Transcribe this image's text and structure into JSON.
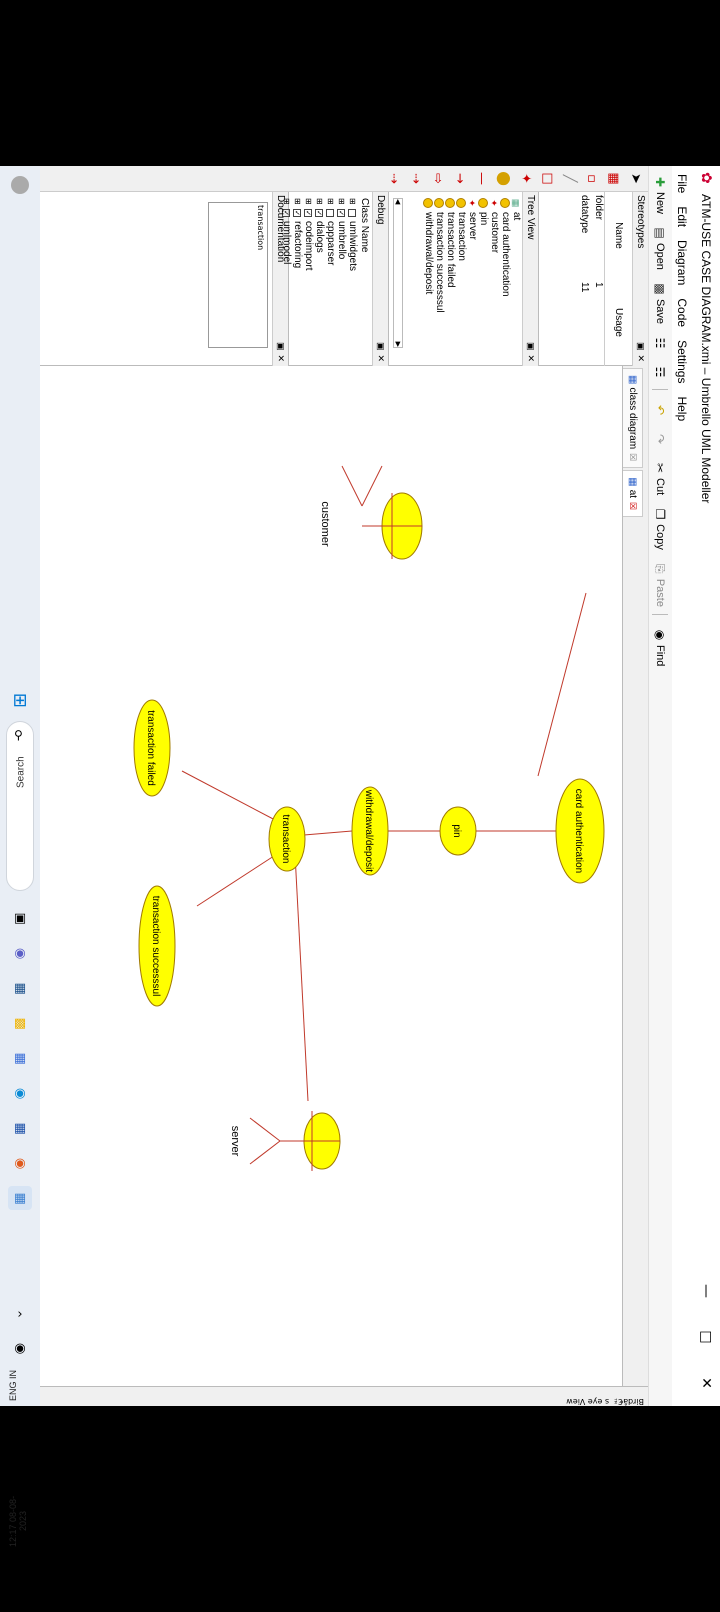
{
  "window": {
    "title": "ATM-USE CASE DIAGRAM.xmi – Umbrello UML Modeller",
    "minimize": "—",
    "maximize": "□",
    "close": "✕"
  },
  "menu": [
    "File",
    "Edit",
    "Diagram",
    "Code",
    "Settings",
    "Help"
  ],
  "toolbar": {
    "new": "New",
    "open": "Open",
    "save": "Save",
    "cut": "Cut",
    "copy": "Copy",
    "paste": "Paste",
    "find": "Find"
  },
  "stereotypes": {
    "title": "Stereotypes",
    "col_name": "Name",
    "col_usage": "Usage",
    "rows": [
      {
        "name": "folder",
        "usage": "1"
      },
      {
        "name": "datatype",
        "usage": "11"
      }
    ]
  },
  "tree_view": {
    "title": "Tree View",
    "items": [
      {
        "label": "at",
        "icon": "folder-icon"
      },
      {
        "label": "card authentication",
        "icon": "usecase-icon"
      },
      {
        "label": "customer",
        "icon": "actor-icon"
      },
      {
        "label": "pin",
        "icon": "usecase-icon"
      },
      {
        "label": "server",
        "icon": "actor-icon"
      },
      {
        "label": "transaction",
        "icon": "usecase-icon"
      },
      {
        "label": "transaction failed",
        "icon": "usecase-icon"
      },
      {
        "label": "transaction successsul",
        "icon": "usecase-icon"
      },
      {
        "label": "withdrawal/deposit",
        "icon": "usecase-icon"
      }
    ]
  },
  "debug": {
    "title": "Debug",
    "header": "Class Name",
    "items": [
      {
        "label": "umlwidgets",
        "checked": false
      },
      {
        "label": "umbrello",
        "checked": true
      },
      {
        "label": "cppparser",
        "checked": false
      },
      {
        "label": "dialogs",
        "checked": true
      },
      {
        "label": "codeimport",
        "checked": true
      },
      {
        "label": "refactoring",
        "checked": true
      },
      {
        "label": "umlmodel",
        "checked": true
      }
    ]
  },
  "documentation": {
    "title": "Documentation",
    "content": "transaction"
  },
  "tabs": [
    {
      "label": "class diagram"
    },
    {
      "label": "at"
    }
  ],
  "right_strip": "Birdâ€™s eye View",
  "diagram": {
    "actors": [
      {
        "id": "customer",
        "label": "customer"
      },
      {
        "id": "server",
        "label": "server"
      }
    ],
    "usecases": [
      {
        "id": "card_auth",
        "label": "card authentication"
      },
      {
        "id": "pin",
        "label": "pin"
      },
      {
        "id": "withdrawal",
        "label": "withdrawal/deposit"
      },
      {
        "id": "transaction",
        "label": "transaction"
      },
      {
        "id": "failed",
        "label": "transaction failed"
      },
      {
        "id": "success",
        "label": "transaction successsul"
      }
    ],
    "colors": {
      "usecase_fill": "#ffff00",
      "line": "#c0392b"
    }
  },
  "taskbar": {
    "search": "Search",
    "lang": "ENG",
    "region": "IN",
    "time": "12:17",
    "date": "08-08-2023"
  }
}
